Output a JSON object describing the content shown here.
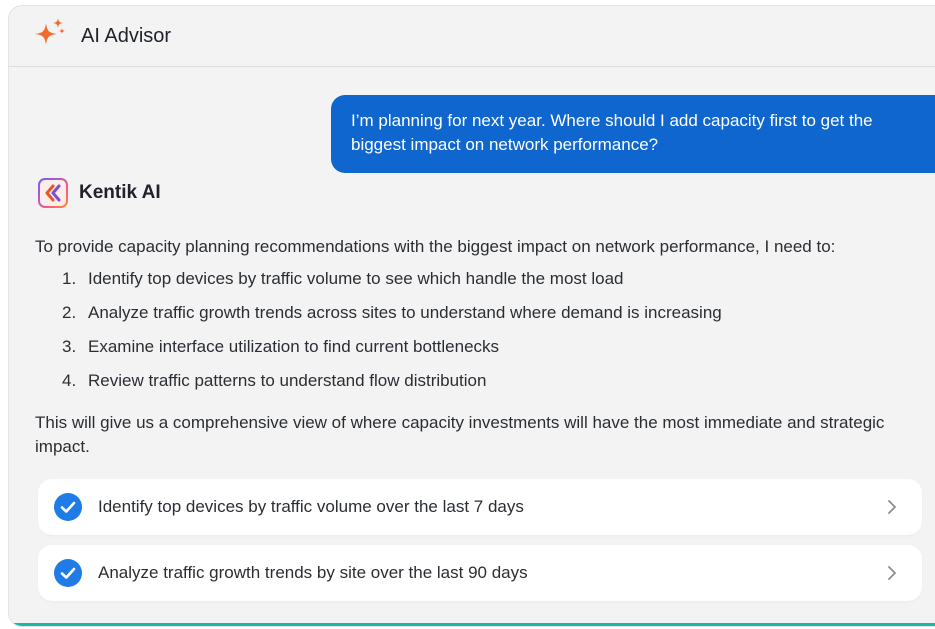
{
  "header": {
    "title": "AI Advisor",
    "icon": "sparkle-icon",
    "icon_color": "#f26b2a"
  },
  "user_message": {
    "text": "I’m planning for next year. Where should I add capacity first to get the biggest impact on network performance?",
    "bubble_color": "#0f66cf"
  },
  "assistant": {
    "name": "Kentik AI",
    "logo": "kentik-logo-icon",
    "intro": "To provide capacity planning recommendations with the biggest impact on network performance, I need to:",
    "steps": [
      {
        "num": "1.",
        "text": "Identify top devices by traffic volume to see which handle the most load"
      },
      {
        "num": "2.",
        "text": "Analyze traffic growth trends across sites to understand where demand is increasing"
      },
      {
        "num": "3.",
        "text": "Examine interface utilization to find current bottlenecks"
      },
      {
        "num": "4.",
        "text": "Review traffic patterns to understand flow distribution"
      }
    ],
    "summary": "This will give us a comprehensive view of where capacity investments will have the most immediate and strategic impact."
  },
  "tasks": [
    {
      "label": "Identify top devices by traffic volume over the last 7 days",
      "status": "complete"
    },
    {
      "label": "Analyze traffic growth trends by site over the last 90 days",
      "status": "complete"
    }
  ],
  "colors": {
    "accent_blue": "#1f7be6",
    "bottom_border": "#17b8a6"
  }
}
